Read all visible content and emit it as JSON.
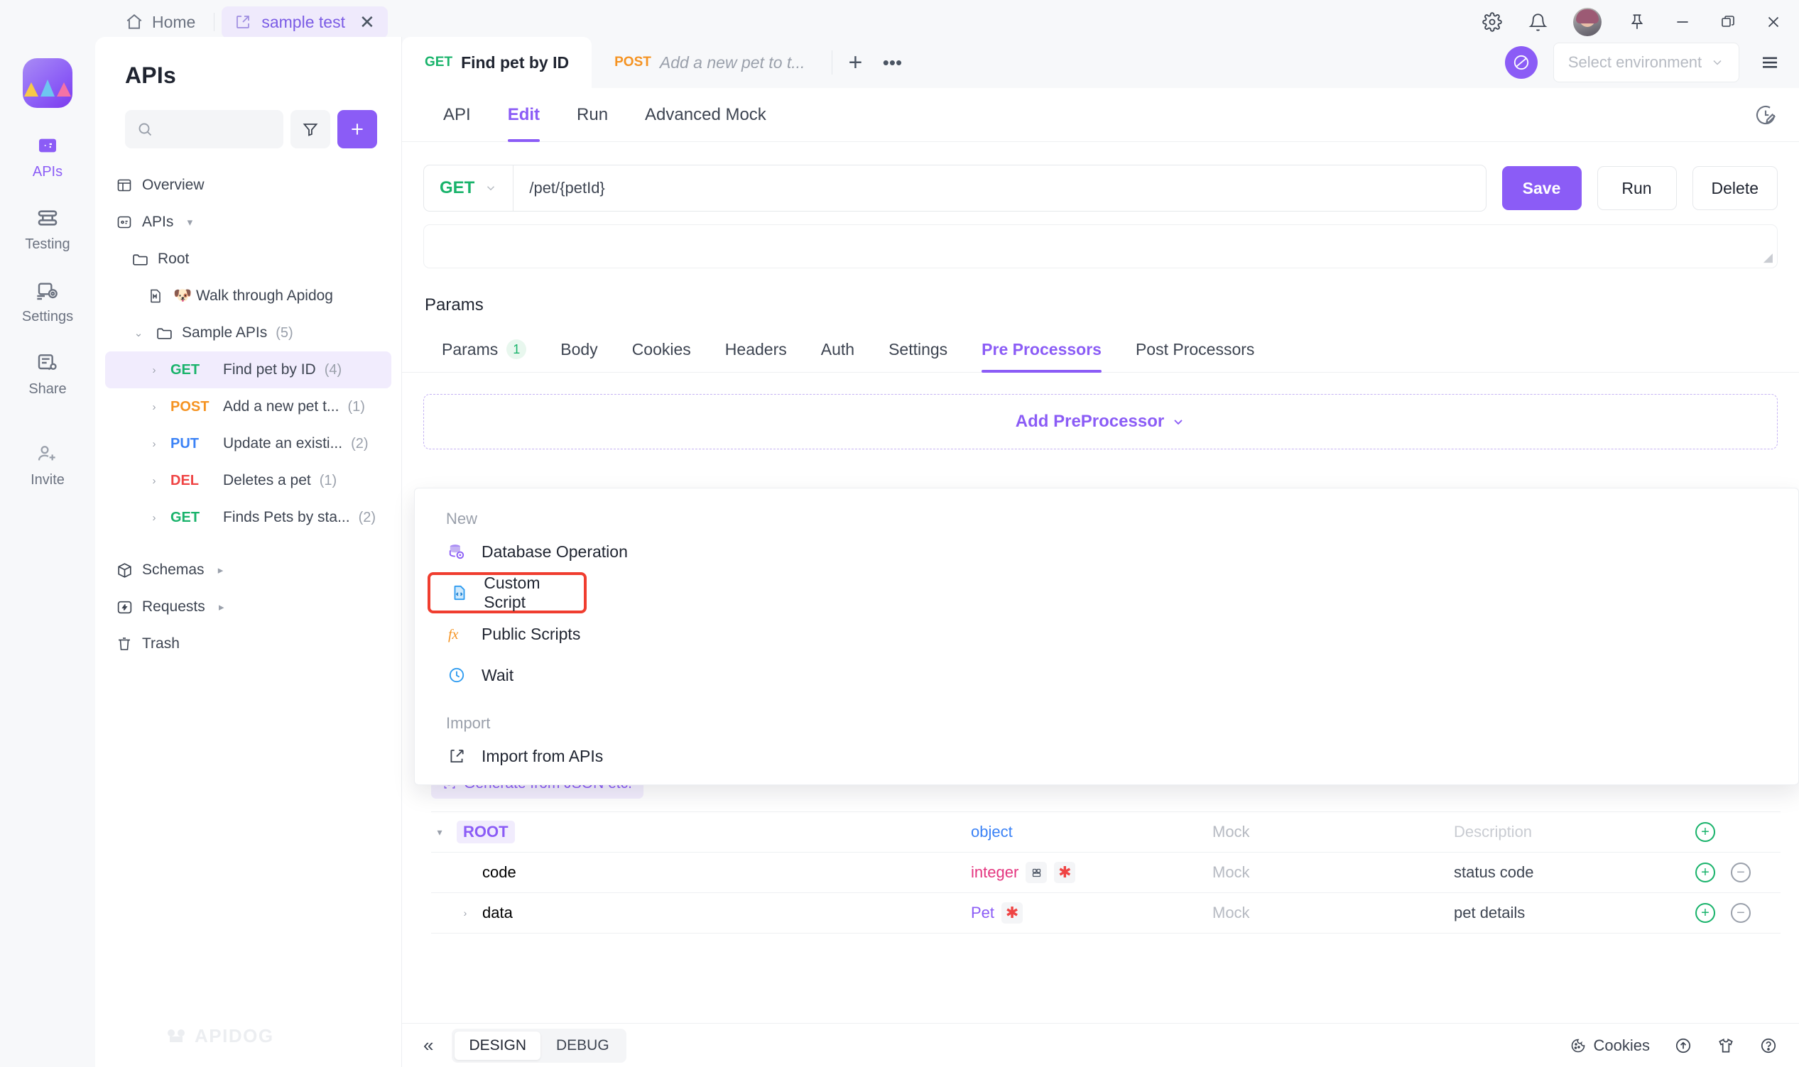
{
  "window": {
    "home_label": "Home",
    "project_tab": "sample test",
    "icons": [
      "gear-icon",
      "bell-icon",
      "avatar",
      "pin-icon",
      "minimize-icon",
      "maximize-icon",
      "close-icon"
    ]
  },
  "rail": {
    "items": [
      {
        "label": "APIs",
        "icon": "apis-icon",
        "active": true
      },
      {
        "label": "Testing",
        "icon": "testing-icon",
        "active": false
      },
      {
        "label": "Settings",
        "icon": "settings-icon",
        "active": false
      },
      {
        "label": "Share",
        "icon": "share-icon",
        "active": false
      },
      {
        "label": "Invite",
        "icon": "invite-icon",
        "active": false
      }
    ]
  },
  "nav": {
    "title": "APIs",
    "search_placeholder": "",
    "search_value": "",
    "filter_icon": "filter-icon",
    "add_icon": "plus-icon",
    "tree": [
      {
        "label": "Overview",
        "icon": "overview-icon",
        "indent": 0,
        "caret": "",
        "count": "",
        "method": "",
        "selected": false
      },
      {
        "label": "APIs",
        "icon": "apis-box-icon",
        "indent": 0,
        "caret": "▾",
        "count": "",
        "method": "",
        "selected": false
      },
      {
        "label": "Root",
        "icon": "folder-icon",
        "indent": 1,
        "caret": "",
        "count": "",
        "method": "",
        "selected": false
      },
      {
        "label": "🐶 Walk through Apidog",
        "icon": "markdown-icon",
        "indent": 2,
        "caret": "",
        "count": "",
        "method": "",
        "selected": false
      },
      {
        "label": "Sample APIs",
        "icon": "folder-icon",
        "indent": 1,
        "caret": "⌄",
        "count": "(5)",
        "method": "",
        "selected": false
      },
      {
        "label": "Find pet by ID",
        "icon": "",
        "indent": 2,
        "caret": "›",
        "count": "(4)",
        "method": "GET",
        "method_class": "m-get",
        "selected": true
      },
      {
        "label": "Add a new pet t...",
        "icon": "",
        "indent": 2,
        "caret": "›",
        "count": "(1)",
        "method": "POST",
        "method_class": "m-post",
        "selected": false
      },
      {
        "label": "Update an existi...",
        "icon": "",
        "indent": 2,
        "caret": "›",
        "count": "(2)",
        "method": "PUT",
        "method_class": "m-put",
        "selected": false
      },
      {
        "label": "Deletes a pet",
        "icon": "",
        "indent": 2,
        "caret": "›",
        "count": "(1)",
        "method": "DEL",
        "method_class": "m-del",
        "selected": false
      },
      {
        "label": "Finds Pets by sta...",
        "icon": "",
        "indent": 2,
        "caret": "›",
        "count": "(2)",
        "method": "GET",
        "method_class": "m-get",
        "selected": false
      },
      {
        "label": "Schemas",
        "icon": "package-icon",
        "indent": 0,
        "caret": "",
        "count": "",
        "method": "",
        "arrow": "▸",
        "selected": false
      },
      {
        "label": "Requests",
        "icon": "requests-icon",
        "indent": 0,
        "caret": "",
        "count": "",
        "method": "",
        "arrow": "▸",
        "selected": false
      },
      {
        "label": "Trash",
        "icon": "trash-icon",
        "indent": 0,
        "caret": "",
        "count": "",
        "method": "",
        "selected": false
      }
    ],
    "watermark": "APIDOG"
  },
  "doc_tabs": [
    {
      "method": "GET",
      "method_class": "m-get",
      "name": "Find pet by ID",
      "active": true
    },
    {
      "method": "POST",
      "method_class": "m-post",
      "name": "Add a new pet to t...",
      "active": false
    }
  ],
  "doc_tab_actions": {
    "add": "+",
    "more": "•••"
  },
  "environment": {
    "placeholder": "Select environment",
    "globe_icon": "environment-globe-icon",
    "menu_icon": "hamburger-icon"
  },
  "subtabs": [
    {
      "label": "API",
      "active": false
    },
    {
      "label": "Edit",
      "active": true
    },
    {
      "label": "Run",
      "active": false
    },
    {
      "label": "Advanced Mock",
      "active": false
    }
  ],
  "subtabs_right_icon": "history-edit-icon",
  "request": {
    "method": "GET",
    "path": "/pet/{petId}",
    "description_value": "",
    "buttons": [
      {
        "label": "Save",
        "style": "primary"
      },
      {
        "label": "Run",
        "style": "default"
      },
      {
        "label": "Delete",
        "style": "default"
      }
    ]
  },
  "params": {
    "section_label": "Params",
    "tabs": [
      {
        "label": "Params",
        "badge": "1",
        "active": false
      },
      {
        "label": "Body",
        "badge": "",
        "active": false
      },
      {
        "label": "Cookies",
        "badge": "",
        "active": false
      },
      {
        "label": "Headers",
        "badge": "",
        "active": false
      },
      {
        "label": "Auth",
        "badge": "",
        "active": false
      },
      {
        "label": "Settings",
        "badge": "",
        "active": false
      },
      {
        "label": "Pre Processors",
        "badge": "",
        "active": true
      },
      {
        "label": "Post Processors",
        "badge": "",
        "active": false
      }
    ]
  },
  "add_preprocessor": {
    "label": "Add PreProcessor",
    "chevron": "⌄"
  },
  "dropdown": {
    "groups": [
      {
        "title": "New",
        "items": [
          {
            "label": "Database Operation",
            "icon": "database-icon",
            "highlighted": false
          },
          {
            "label": "Custom Script",
            "icon": "custom-script-icon",
            "highlighted": true
          },
          {
            "label": "Public Scripts",
            "icon": "fx-icon",
            "highlighted": false
          },
          {
            "label": "Wait",
            "icon": "clock-icon",
            "highlighted": false
          }
        ]
      },
      {
        "title": "Import",
        "items": [
          {
            "label": "Import from APIs",
            "icon": "import-icon",
            "highlighted": false
          }
        ]
      }
    ],
    "highlight_color": "#f03d2f"
  },
  "schema": {
    "generate_label": "Generate from JSON etc.",
    "generate_icon": "generate-json-icon",
    "rows": [
      {
        "caret": "▾",
        "name": "ROOT",
        "name_pill": true,
        "indent": 0,
        "type": "object",
        "type_class": "t-object",
        "lock": false,
        "required": false,
        "mock": "Mock",
        "desc": "Description",
        "desc_placeholder": true,
        "add": true,
        "remove": false
      },
      {
        "caret": "",
        "name": "code",
        "name_pill": false,
        "indent": 1,
        "type": "integer",
        "type_class": "t-integer",
        "lock": true,
        "required": true,
        "mock": "Mock",
        "desc": "status code",
        "desc_placeholder": false,
        "add": true,
        "remove": true
      },
      {
        "caret": "›",
        "name": "data",
        "name_pill": false,
        "indent": 1,
        "type": "Pet",
        "type_class": "t-pet",
        "lock": false,
        "required": true,
        "mock": "Mock",
        "desc": "pet details",
        "desc_placeholder": false,
        "add": true,
        "remove": true
      }
    ]
  },
  "statusbar": {
    "collapse_icon": "collapse-left-icon",
    "modes": [
      {
        "label": "DESIGN",
        "active": true
      },
      {
        "label": "DEBUG",
        "active": false
      }
    ],
    "cookies_label": "Cookies",
    "right_icons": [
      "cookie-icon",
      "upload-circle-icon",
      "shirt-icon",
      "help-icon"
    ]
  }
}
